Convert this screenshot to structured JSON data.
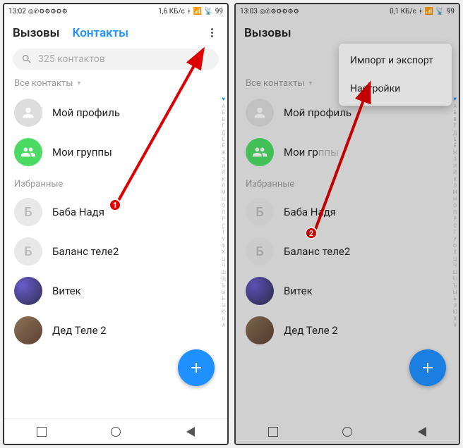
{
  "status": {
    "time1": "13:02",
    "time2": "13:03",
    "speed1": "1,6 КБ/с",
    "speed2": "0,1 КБ/с",
    "battery": "99"
  },
  "tabs": {
    "calls": "Вызовы",
    "contacts": "Контакты"
  },
  "search": {
    "placeholder": "325 контактов"
  },
  "sections": {
    "all_contacts": "Все контакты",
    "favorites": "Избранные"
  },
  "rows": {
    "profile": "Мой профиль",
    "groups": "Мои группы",
    "groups_cut": "Мои гр",
    "contact1": "Баба Надя",
    "contact2": "Баланс теле2",
    "contact3": "Витек",
    "contact4": "Дед Теле 2",
    "letter_b": "Б",
    "letter_ppy": "ппы"
  },
  "menu": {
    "import_export": "Импорт и экспорт",
    "settings": "Настройки"
  },
  "badges": {
    "one": "1",
    "two": "2"
  },
  "alpha": [
    "А",
    "Б",
    "В",
    "Г",
    "Д",
    "Е",
    "Ё",
    "Ж",
    "З",
    "И",
    "Й",
    "К",
    "Л",
    "М",
    "Н",
    "О",
    "П",
    "Р",
    "С",
    "Т",
    "У",
    "Ф",
    "Х",
    "Ц",
    "Ч",
    "Ш",
    "Щ",
    "Ъ",
    "Ы",
    "Ь",
    "Э",
    "Ю",
    "Я",
    "#"
  ]
}
